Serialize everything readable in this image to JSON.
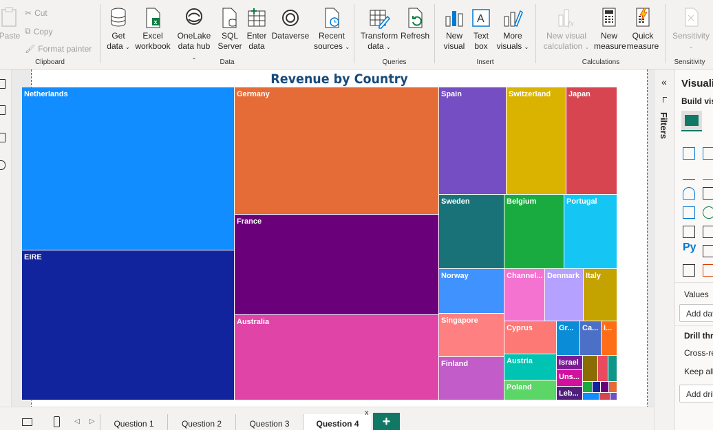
{
  "ribbon": {
    "clipboard": {
      "label": "Clipboard",
      "paste": "Paste",
      "cut": "Cut",
      "copy": "Copy",
      "format_painter": "Format painter"
    },
    "data": {
      "label": "Data",
      "get_data": [
        "Get",
        "data"
      ],
      "excel": [
        "Excel",
        "workbook"
      ],
      "onelake": [
        "OneLake",
        "data hub"
      ],
      "sql": [
        "SQL",
        "Server"
      ],
      "enter": [
        "Enter",
        "data"
      ],
      "dataverse": "Dataverse",
      "recent": [
        "Recent",
        "sources"
      ]
    },
    "queries": {
      "label": "Queries",
      "transform": [
        "Transform",
        "data"
      ],
      "refresh": "Refresh"
    },
    "insert": {
      "label": "Insert",
      "new_visual": [
        "New",
        "visual"
      ],
      "text_box": [
        "Text",
        "box"
      ],
      "more_visuals": [
        "More",
        "visuals"
      ]
    },
    "calculations": {
      "label": "Calculations",
      "new_visual_calc": [
        "New visual",
        "calculation"
      ],
      "new_measure": [
        "New",
        "measure"
      ],
      "quick_measure": [
        "Quick",
        "measure"
      ]
    },
    "sensitivity": {
      "label": "Sensitivity",
      "button": "Sensitivity"
    }
  },
  "chart_data": {
    "type": "treemap",
    "title": "Revenue by Country",
    "tiles": [
      {
        "label": "Netherlands",
        "color": "#118dff"
      },
      {
        "label": "EIRE",
        "color": "#12239e"
      },
      {
        "label": "Germany",
        "color": "#e66c37"
      },
      {
        "label": "France",
        "color": "#6b007b"
      },
      {
        "label": "Australia",
        "color": "#e044a7"
      },
      {
        "label": "Spain",
        "color": "#744ec2"
      },
      {
        "label": "Switzerland",
        "color": "#d9b300"
      },
      {
        "label": "Japan",
        "color": "#d64550"
      },
      {
        "label": "Sweden",
        "color": "#197278"
      },
      {
        "label": "Belgium",
        "color": "#1aab40"
      },
      {
        "label": "Portugal",
        "color": "#15c6f4"
      },
      {
        "label": "Norway",
        "color": "#4092ff"
      },
      {
        "label": "Channel...",
        "color": "#f472d0"
      },
      {
        "label": "Denmark",
        "color": "#b5a1ff"
      },
      {
        "label": "Italy",
        "color": "#c4a200"
      },
      {
        "label": "Singapore",
        "color": "#ff8080"
      },
      {
        "label": "Cyprus",
        "color": "#fd7976"
      },
      {
        "label": "Gr...",
        "color": "#0b8cd6"
      },
      {
        "label": "Ca...",
        "color": "#4b70c6"
      },
      {
        "label": "I...",
        "color": "#ff6e17"
      },
      {
        "label": "Finland",
        "color": "#c15cc8"
      },
      {
        "label": "Austria",
        "color": "#00c4b3"
      },
      {
        "label": "Israel",
        "color": "#7a1a95"
      },
      {
        "label": "Uns...",
        "color": "#d1119e"
      },
      {
        "label": "Poland",
        "color": "#5bd667"
      },
      {
        "label": "Leb...",
        "color": "#4f1f7b"
      }
    ]
  },
  "filters": {
    "label": "Filters"
  },
  "viz_pane": {
    "title": "Visualizations",
    "build": "Build visual",
    "values": "Values",
    "add_data": "Add data fields here",
    "drill": "Drill through",
    "cross": "Cross-report",
    "keep": "Keep all filters",
    "add_drill": "Add drill-through fields here"
  },
  "tabs": [
    "Question 1",
    "Question 2",
    "Question 3",
    "Question 4"
  ],
  "active_tab": "Question 4",
  "add_tab": "+"
}
